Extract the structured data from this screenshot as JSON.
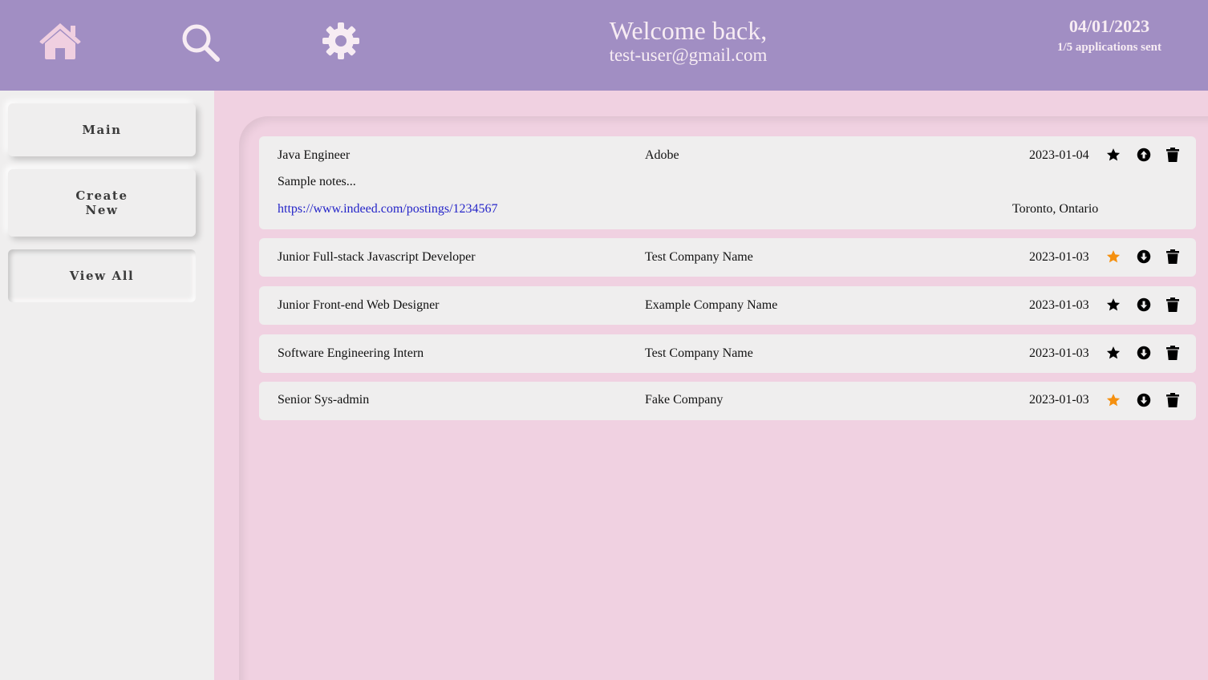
{
  "header": {
    "icons": [
      "home-icon",
      "search-icon",
      "gear-icon"
    ],
    "welcome": "Welcome back,",
    "user_email": "test-user@gmail.com",
    "date": "04/01/2023",
    "applications_status": "1/5 applications sent"
  },
  "sidebar": {
    "items": [
      {
        "label": "Main"
      },
      {
        "label": "Create New"
      },
      {
        "label": "View All",
        "active": true
      }
    ]
  },
  "applications": [
    {
      "title": "Java Engineer",
      "company": "Adobe",
      "date": "2023-01-04",
      "starred": false,
      "expanded": true,
      "notes": "Sample notes...",
      "link": "https://www.indeed.com/postings/1234567",
      "location": "Toronto, Ontario"
    },
    {
      "title": "Junior Full-stack Javascript Developer",
      "company": "Test Company Name",
      "date": "2023-01-03",
      "starred": true,
      "expanded": false
    },
    {
      "title": "Junior Front-end Web Designer",
      "company": "Example Company Name",
      "date": "2023-01-03",
      "starred": false,
      "expanded": false
    },
    {
      "title": "Software Engineering Intern",
      "company": "Test Company Name",
      "date": "2023-01-03",
      "starred": false,
      "expanded": false
    },
    {
      "title": "Senior Sys-admin",
      "company": "Fake Company",
      "date": "2023-01-03",
      "starred": true,
      "expanded": false
    }
  ],
  "colors": {
    "header_bg": "#a18ec3",
    "page_bg": "#f0d1e1",
    "panel_bg": "#efeeee",
    "star_active": "#f5900f",
    "star_inactive": "#000000",
    "link": "#2424c8",
    "home_icon": "#f0cfe0"
  }
}
